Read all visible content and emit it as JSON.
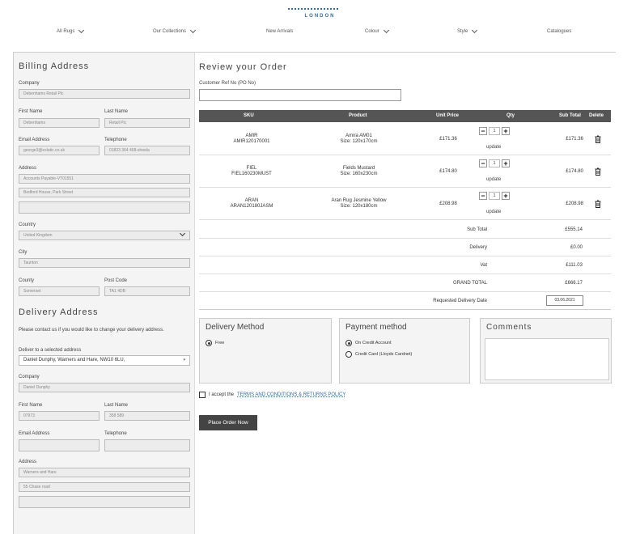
{
  "brand": {
    "subtitle": "LONDON"
  },
  "nav": [
    {
      "label": "All Rugs",
      "has_dropdown": true
    },
    {
      "label": "Our Collections",
      "has_dropdown": true
    },
    {
      "label": "New Arrivals",
      "has_dropdown": false
    },
    {
      "label": "Colour",
      "has_dropdown": true
    },
    {
      "label": "Style",
      "has_dropdown": true
    },
    {
      "label": "Catalogues",
      "has_dropdown": false
    }
  ],
  "billing": {
    "title": "Billing Address",
    "company_label": "Company",
    "company": "Debenhams Retail Plc",
    "first_name_label": "First Name",
    "first_name": "Debenhams",
    "last_name_label": "Last Name",
    "last_name": "Retail Plc",
    "email_label": "Email Address",
    "email": "george3@eslatic.co.uk",
    "phone_label": "Telephone",
    "phone": "01823 364 468-sheela",
    "address_label": "Address",
    "address1": "Accounts Payable-VT01551",
    "address2": "Bedford House, Park Street",
    "address3": "",
    "country_label": "Country",
    "country": "United Kingdom",
    "city_label": "City",
    "city": "Taunton",
    "county_label": "County",
    "county": "Somerset",
    "postcode_label": "Post Code",
    "postcode": "TA1 4DB"
  },
  "delivery": {
    "title": "Delivery Address",
    "note": "Please contact us if you would like to change your delivery address.",
    "deliver_to_label": "Deliver to a selected address",
    "deliver_to": "Daniel Dunphy, Warners and Hare, NW10 6LU,",
    "company_label": "Company",
    "company": "Daniel Dunphy",
    "first_name_label": "First Name",
    "first_name": "07973",
    "last_name_label": "Last Name",
    "last_name": "358 589",
    "email_label": "Email Address",
    "email": "",
    "phone_label": "Telephone",
    "phone": "",
    "address_label": "Address",
    "address1": "Warners and Hare",
    "address2": "55 Chase road",
    "address3": ""
  },
  "review": {
    "title": "Review your Order",
    "po_label": "Customer Ref No (PO No)",
    "po_value": "",
    "columns": {
      "sku": "SKU",
      "product": "Product",
      "unit_price": "Unit Price",
      "qty": "Qty",
      "sub_total": "Sub Total",
      "delete": "Delete"
    },
    "items": [
      {
        "sku1": "AMIR",
        "sku2": "AMIR120170001",
        "product1": "Amira AM01",
        "product2": "Size: 120x170cm",
        "unit_price": "£171.36",
        "qty": "1",
        "update": "update",
        "sub_total": "£171.36"
      },
      {
        "sku1": "FIEL",
        "sku2": "FIEL160230MUST",
        "product1": "Fields Mustard",
        "product2": "Size: 160x230cm",
        "unit_price": "£174.80",
        "qty": "1",
        "update": "update",
        "sub_total": "£174.80"
      },
      {
        "sku1": "ARAN",
        "sku2": "ARAN120180JASM",
        "product1": "Aran Rug Jesmine Yellow",
        "product2": "Size: 120x180cm",
        "unit_price": "£208.98",
        "qty": "1",
        "update": "update",
        "sub_total": "£208.98"
      }
    ],
    "totals": [
      {
        "label": "Sub Total",
        "value": "£555.14"
      },
      {
        "label": "Delivery",
        "value": "£0.00"
      },
      {
        "label": "Vat",
        "value": "£111.03"
      },
      {
        "label": "GRAND TOTAL",
        "value": "£666.17"
      }
    ],
    "requested_date_label": "Requested Delivery Date",
    "requested_date": "03.06.2021"
  },
  "delivery_method": {
    "title": "Delivery Method",
    "option": "Free"
  },
  "payment_method": {
    "title": "Payment method",
    "option1": "On Credit Account",
    "option2": "Credit Card (Lloyds Cardnet)"
  },
  "comments": {
    "title": "Comments",
    "value": ""
  },
  "terms": {
    "prefix": "I accept the",
    "link": "TERMS AND CONDITIONS & RETURNS POLICY"
  },
  "place_order": "Place Order Now"
}
